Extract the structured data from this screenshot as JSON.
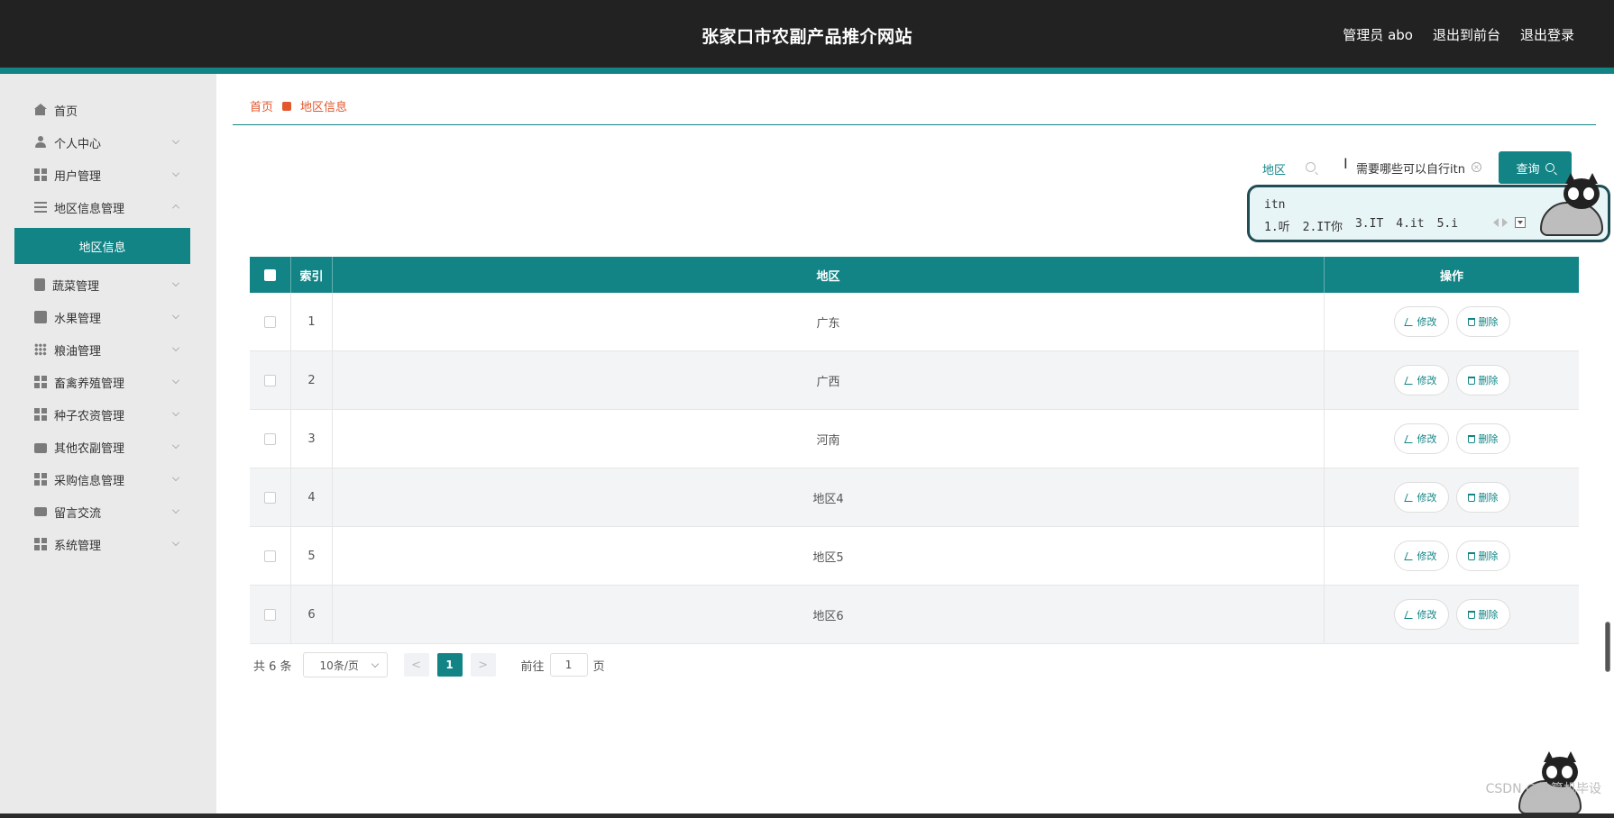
{
  "header": {
    "site_title": "张家口市农副产品推介网站",
    "admin_label": "管理员 abo",
    "to_front_label": "退出到前台",
    "logout_label": "退出登录"
  },
  "sidebar": {
    "items": [
      {
        "label": "首页",
        "icon": "home-icon"
      },
      {
        "label": "个人中心",
        "icon": "user-icon"
      },
      {
        "label": "用户管理",
        "icon": "grid-icon"
      },
      {
        "label": "地区信息管理",
        "icon": "list-icon"
      },
      {
        "label": "地区信息",
        "icon": ""
      },
      {
        "label": "蔬菜管理",
        "icon": "clipboard-icon"
      },
      {
        "label": "水果管理",
        "icon": "chart-icon"
      },
      {
        "label": "粮油管理",
        "icon": "dots-grid-icon"
      },
      {
        "label": "畜禽养殖管理",
        "icon": "grid-icon"
      },
      {
        "label": "种子农资管理",
        "icon": "grid-icon"
      },
      {
        "label": "其他农副管理",
        "icon": "briefcase-icon"
      },
      {
        "label": "采购信息管理",
        "icon": "grid-icon"
      },
      {
        "label": "留言交流",
        "icon": "video-icon"
      },
      {
        "label": "系统管理",
        "icon": "grid-icon"
      }
    ]
  },
  "breadcrumb": {
    "home": "首页",
    "current": "地区信息"
  },
  "search": {
    "label": "地区",
    "value": "需要哪些可以自行itn",
    "button_label": "查询"
  },
  "ime": {
    "input": "itn",
    "candidates": [
      "1.听",
      "2.IT你",
      "3.IT",
      "4.it",
      "5.i"
    ]
  },
  "table": {
    "columns": [
      "索引",
      "地区",
      "操作"
    ],
    "edit_label": "修改",
    "delete_label": "删除",
    "rows": [
      {
        "index": "1",
        "region": "广东"
      },
      {
        "index": "2",
        "region": "广西"
      },
      {
        "index": "3",
        "region": "河南"
      },
      {
        "index": "4",
        "region": "地区4"
      },
      {
        "index": "5",
        "region": "地区5"
      },
      {
        "index": "6",
        "region": "地区6"
      }
    ]
  },
  "pagination": {
    "total_label": "共 6 条",
    "page_size": "10条/页",
    "prev": "<",
    "next": ">",
    "current_page": "1",
    "goto_label": "前往",
    "goto_value": "1",
    "page_suffix": "页"
  },
  "watermark": "CSDN @计算机毕设",
  "colors": {
    "accent": "#128486",
    "breadcrumb": "#e4572e",
    "header_bg": "#222222"
  }
}
